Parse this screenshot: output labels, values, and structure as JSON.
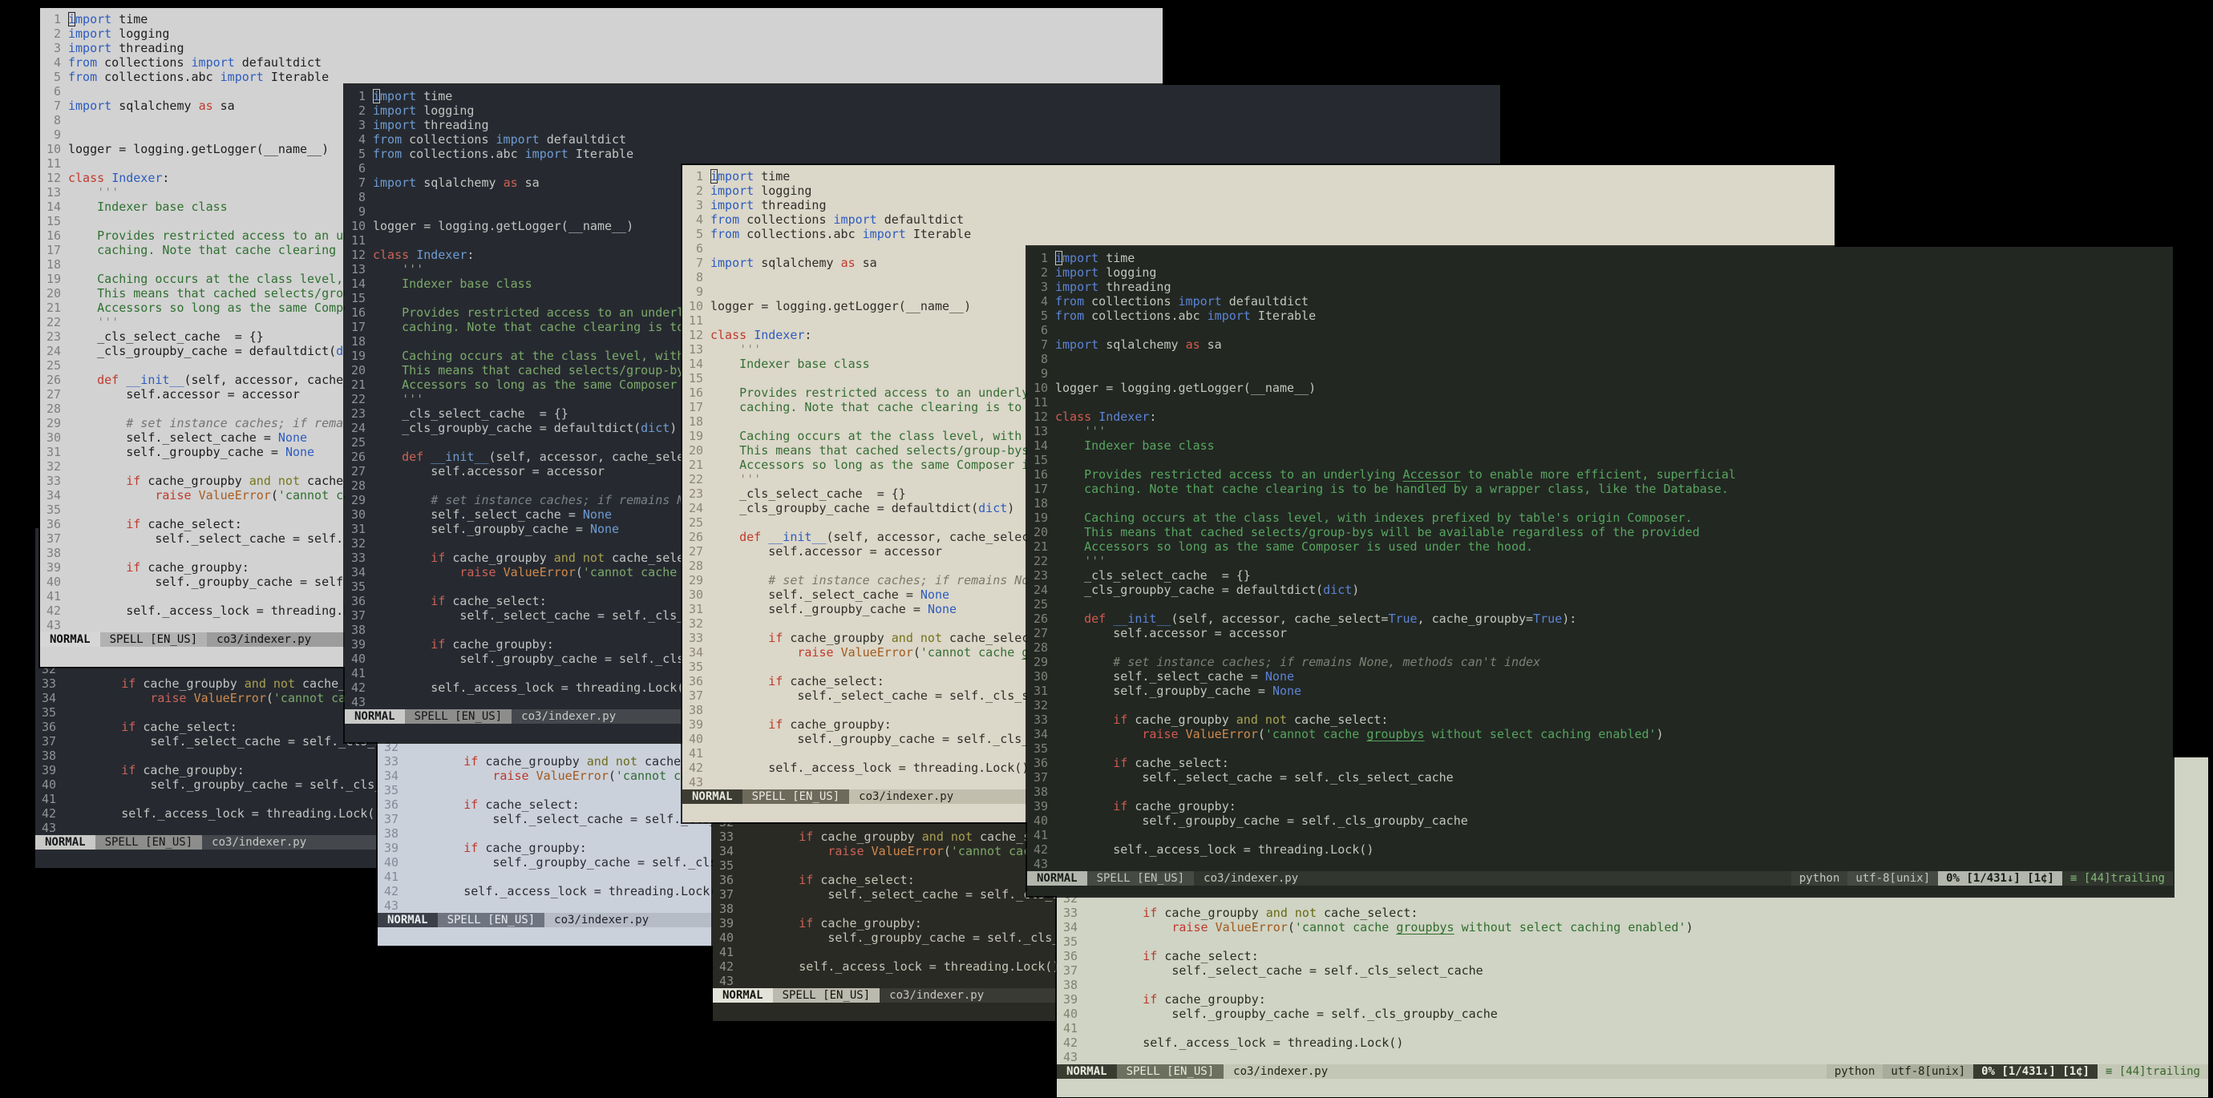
{
  "desktop": {
    "background": "#000000"
  },
  "editor": {
    "filename": "co3/indexer.py",
    "language": "python"
  },
  "status": {
    "mode": "NORMAL",
    "spell": "SPELL [EN_US]",
    "filename": "co3/indexer.py",
    "filetype": "python",
    "encoding": "utf-8[unix]",
    "position": "0% [1/431↓] [1¢]",
    "whitespace_warning": "≡ [44]trailing"
  },
  "themes": {
    "light_gray": {
      "bg": "#d2d2d2",
      "fg": "#1e1e1e",
      "gut": "#7f7f7f",
      "blue": "#2d5cbf",
      "red": "#c03a2c",
      "olive": "#76761c",
      "orange": "#a85c1e",
      "green": "#2f7030",
      "delim": "#8a8a8a",
      "comment": "#747474",
      "bar": "#9c9c9c",
      "file": "#121212",
      "s1bg": "#d6d6d6",
      "s1fg": "#0e0e0e",
      "s2bg": "#b2b2b2",
      "s2fg": "#0e0e0e",
      "pybg": "#909090",
      "pyfg": "#121212",
      "encbg": "#a6a6a6",
      "encfg": "#121212",
      "posbg": "#d6d6d6",
      "posfg": "#0e0e0e",
      "warn": "#2d682a"
    },
    "dark_slate": {
      "bg": "#262a30",
      "fg": "#c2c5c2",
      "gut": "#8f9398",
      "blue": "#6f9bd2",
      "red": "#cb6257",
      "olive": "#a9a051",
      "orange": "#d0894e",
      "green": "#7ca96a",
      "delim": "#96968a",
      "comment": "#7d8287",
      "bar": "#44484d",
      "file": "#c8c8c4",
      "s1bg": "#c9c9c7",
      "s1fg": "#141619",
      "s2bg": "#8d8d8b",
      "s2fg": "#141619",
      "pybg": "#4d5156",
      "pyfg": "#c8c8c4",
      "encbg": "#565a5f",
      "encfg": "#c8c8c4",
      "posbg": "#c9c9c7",
      "posfg": "#141619",
      "warn": "#8ab87e"
    },
    "cream": {
      "bg": "#dbd7c9",
      "fg": "#2f2f29",
      "gut": "#8a877a",
      "blue": "#2d5cbf",
      "red": "#c03a2c",
      "olive": "#72721a",
      "orange": "#a45a1e",
      "green": "#356e34",
      "delim": "#8e8b7d",
      "comment": "#7b7969",
      "bar": "#c2beae",
      "file": "#24241c",
      "s1bg": "#3c3c32",
      "s1fg": "#eae9e0",
      "s2bg": "#6e6a5b",
      "s2fg": "#eae9e0",
      "pybg": "#b4b0a0",
      "pyfg": "#24241c",
      "encbg": "#a8a494",
      "encfg": "#24241c",
      "posbg": "#3c3c32",
      "posfg": "#eae9e0",
      "warn": "#33622a"
    },
    "dark_green": {
      "bg": "#222722",
      "fg": "#c3c6bd",
      "gut": "#7d8279",
      "blue": "#5c83d4",
      "red": "#d15a4e",
      "olive": "#a7a351",
      "orange": "#d0894e",
      "green": "#57a55f",
      "delim": "#7e897b",
      "comment": "#7b8174",
      "bar": "#31362f",
      "file": "#c4c7bf",
      "s1bg": "#b2b6ad",
      "s1fg": "#171c16",
      "s2bg": "#454a42",
      "s2fg": "#c4c7bf",
      "pybg": "#3a3f37",
      "pyfg": "#c4c7bf",
      "encbg": "#454a42",
      "encfg": "#c4c7bf",
      "posbg": "#b2b6ad",
      "posfg": "#171c16",
      "warn": "#84b878"
    },
    "light_blue": {
      "bg": "#cbd1db",
      "fg": "#292b32",
      "gut": "#848a98",
      "blue": "#2d54b4",
      "red": "#bd382d",
      "olive": "#6b6b1a",
      "orange": "#a2581e",
      "green": "#326c33",
      "delim": "#878c99",
      "comment": "#757a87",
      "bar": "#b6bcc6",
      "file": "#1f2128",
      "s1bg": "#3a3f48",
      "s1fg": "#e9ecf1",
      "s2bg": "#6e7581",
      "s2fg": "#e9ecf1",
      "pybg": "#a9afb9",
      "pyfg": "#1f2128",
      "encbg": "#9da3ad",
      "encfg": "#1f2128",
      "posbg": "#3a3f48",
      "posfg": "#e9ecf1",
      "warn": "#2d682a"
    },
    "dark_warm": {
      "bg": "#2a2a24",
      "fg": "#c4c4b8",
      "gut": "#8f8f89",
      "blue": "#6f9bd2",
      "red": "#cb6257",
      "olive": "#a9a051",
      "orange": "#d0894e",
      "green": "#7ca96a",
      "delim": "#96968a",
      "comment": "#82827a",
      "bar": "#3a3a34",
      "file": "#c8c8be",
      "s1bg": "#e3e3da",
      "s1fg": "#14140e",
      "s2bg": "#babaae",
      "s2fg": "#14140e",
      "pybg": "#44443e",
      "pyfg": "#c8c8be",
      "encbg": "#4e4e48",
      "encfg": "#c8c8be",
      "posbg": "#e3e3da",
      "posfg": "#14140e",
      "warn": "#8ab87e"
    },
    "light_green": {
      "bg": "#cfd4c4",
      "fg": "#2a2d23",
      "gut": "#7e8470",
      "blue": "#2d54b4",
      "red": "#bd382d",
      "olive": "#686814",
      "orange": "#a2581e",
      "green": "#316e2d",
      "delim": "#848a75",
      "comment": "#747b66",
      "bar": "#c3c7b5",
      "file": "#21251a",
      "s1bg": "#383c30",
      "s1fg": "#eaecdf",
      "s2bg": "#6b705f",
      "s2fg": "#eaecdf",
      "pybg": "#b6baa8",
      "pyfg": "#21251a",
      "encbg": "#a8ac9a",
      "encfg": "#21251a",
      "posbg": "#383c30",
      "posfg": "#eaecdf",
      "warn": "#37652a"
    }
  },
  "windows": [
    {
      "id": "small-1",
      "theme": "dark_slate",
      "first_line": 23,
      "last_line": 43,
      "cursor": false
    },
    {
      "id": "small-2",
      "theme": "light_blue",
      "first_line": 23,
      "last_line": 43,
      "cursor": false
    },
    {
      "id": "small-3",
      "theme": "dark_warm",
      "first_line": 23,
      "last_line": 43,
      "cursor": false
    },
    {
      "id": "small-4",
      "theme": "light_green",
      "first_line": 23,
      "last_line": 43,
      "cursor": false
    },
    {
      "id": "big-1",
      "theme": "light_gray",
      "first_line": 1,
      "last_line": 43,
      "cursor": true
    },
    {
      "id": "big-2",
      "theme": "dark_slate",
      "first_line": 1,
      "last_line": 43,
      "cursor": true
    },
    {
      "id": "big-3",
      "theme": "cream",
      "first_line": 1,
      "last_line": 43,
      "cursor": true
    },
    {
      "id": "big-4",
      "theme": "dark_green",
      "first_line": 1,
      "last_line": 43,
      "cursor": true
    }
  ],
  "code": {
    "lines": [
      [
        [
          "b",
          "import"
        ],
        [
          "p",
          " time"
        ]
      ],
      [
        [
          "b",
          "import"
        ],
        [
          "p",
          " logging"
        ]
      ],
      [
        [
          "b",
          "import"
        ],
        [
          "p",
          " threading"
        ]
      ],
      [
        [
          "b",
          "from"
        ],
        [
          "p",
          " collections "
        ],
        [
          "b",
          "import"
        ],
        [
          "p",
          " defaultdict"
        ]
      ],
      [
        [
          "b",
          "from"
        ],
        [
          "p",
          " collections.abc "
        ],
        [
          "b",
          "import"
        ],
        [
          "p",
          " Iterable"
        ]
      ],
      [],
      [
        [
          "b",
          "import"
        ],
        [
          "p",
          " sqlalchemy "
        ],
        [
          "r",
          "as"
        ],
        [
          "p",
          " sa"
        ]
      ],
      [],
      [],
      [
        [
          "p",
          "logger = logging.getLogger(__name__)"
        ]
      ],
      [],
      [
        [
          "r",
          "class"
        ],
        [
          "p",
          " "
        ],
        [
          "b",
          "Indexer"
        ],
        [
          "p",
          ":"
        ]
      ],
      [
        [
          "p",
          "    "
        ],
        [
          "d",
          "'''"
        ]
      ],
      [
        [
          "p",
          "    "
        ],
        [
          "g",
          "Indexer base class"
        ]
      ],
      [],
      [
        [
          "p",
          "    "
        ],
        [
          "g",
          "Provides restricted access to an underlying "
        ],
        [
          "gs",
          "Accessor"
        ],
        [
          "g",
          " to enable more efficient, superficial"
        ]
      ],
      [
        [
          "p",
          "    "
        ],
        [
          "g",
          "caching. Note that cache clearing is to be handled by a wrapper class, like the Database."
        ]
      ],
      [],
      [
        [
          "p",
          "    "
        ],
        [
          "g",
          "Caching occurs at the class level, with indexes prefixed by table's origin Composer."
        ]
      ],
      [
        [
          "p",
          "    "
        ],
        [
          "g",
          "This means that cached selects/group-bys will be available regardless of the provided"
        ]
      ],
      [
        [
          "p",
          "    "
        ],
        [
          "g",
          "Accessors so long as the same Composer is used under the hood."
        ]
      ],
      [
        [
          "p",
          "    "
        ],
        [
          "d",
          "'''"
        ]
      ],
      [
        [
          "p",
          "    _cls_select_cache  = {}"
        ]
      ],
      [
        [
          "p",
          "    _cls_groupby_cache = defaultdict("
        ],
        [
          "b",
          "dict"
        ],
        [
          "p",
          ")"
        ]
      ],
      [],
      [
        [
          "p",
          "    "
        ],
        [
          "r",
          "def"
        ],
        [
          "p",
          " "
        ],
        [
          "b",
          "__init__"
        ],
        [
          "p",
          "(self, accessor, cache_select="
        ],
        [
          "b",
          "True"
        ],
        [
          "p",
          ", cache_groupby="
        ],
        [
          "b",
          "True"
        ],
        [
          "p",
          "):"
        ]
      ],
      [
        [
          "p",
          "        self.accessor = accessor"
        ]
      ],
      [],
      [
        [
          "p",
          "        "
        ],
        [
          "c",
          "# set instance caches; if remains None, methods can't index"
        ]
      ],
      [
        [
          "p",
          "        self._select_cache = "
        ],
        [
          "b",
          "None"
        ]
      ],
      [
        [
          "p",
          "        self._groupby_cache = "
        ],
        [
          "b",
          "None"
        ]
      ],
      [],
      [
        [
          "p",
          "        "
        ],
        [
          "r",
          "if"
        ],
        [
          "p",
          " cache_groupby "
        ],
        [
          "o",
          "and"
        ],
        [
          "p",
          " "
        ],
        [
          "o",
          "not"
        ],
        [
          "p",
          " cache_select:"
        ]
      ],
      [
        [
          "p",
          "            "
        ],
        [
          "r",
          "raise"
        ],
        [
          "p",
          " "
        ],
        [
          "e",
          "ValueError"
        ],
        [
          "p",
          "("
        ],
        [
          "g",
          "'cannot cache "
        ],
        [
          "gs",
          "groupbys"
        ],
        [
          "g",
          " without select caching enabled'"
        ],
        [
          "p",
          ")"
        ]
      ],
      [],
      [
        [
          "p",
          "        "
        ],
        [
          "r",
          "if"
        ],
        [
          "p",
          " cache_select:"
        ]
      ],
      [
        [
          "p",
          "            self._select_cache = self._cls_select_cache"
        ]
      ],
      [],
      [
        [
          "p",
          "        "
        ],
        [
          "r",
          "if"
        ],
        [
          "p",
          " cache_groupby:"
        ]
      ],
      [
        [
          "p",
          "            self._groupby_cache = self._cls_groupby_cache"
        ]
      ],
      [],
      [
        [
          "p",
          "        self._access_lock = threading.Lock()"
        ]
      ],
      []
    ]
  }
}
